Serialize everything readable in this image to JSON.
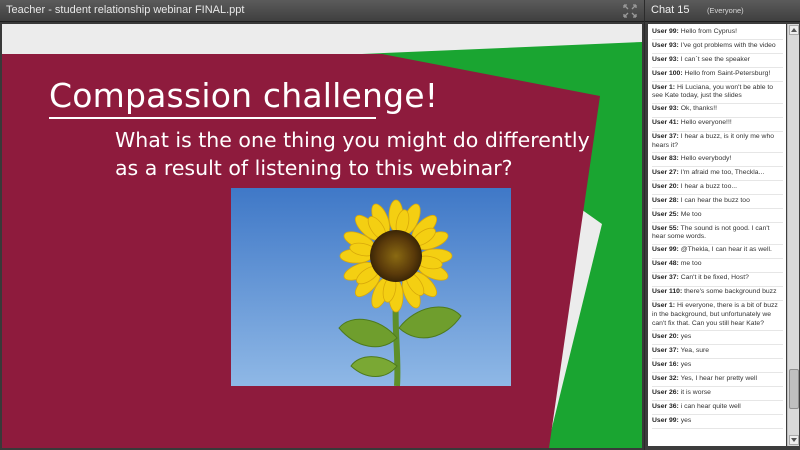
{
  "presentation": {
    "title": "Teacher - student relationship webinar FINAL.ppt",
    "slide": {
      "heading": "Compassion challenge!",
      "question": "What is the one thing you might do differently as a result of listening to this webinar?"
    }
  },
  "chat": {
    "title": "Chat 15",
    "scope": "(Everyone)",
    "messages": [
      {
        "user": "User 99:",
        "text": "Hello from Cyprus!"
      },
      {
        "user": "User 93:",
        "text": "I've got problems with the video"
      },
      {
        "user": "User 93:",
        "text": "I can`t see the speaker"
      },
      {
        "user": "User 100:",
        "text": "Hello from Saint-Petersburg!"
      },
      {
        "user": "User 1:",
        "text": "Hi Luciana, you won't be able to see Kate today, just the slides"
      },
      {
        "user": "User 93:",
        "text": "Ok, thanks!!"
      },
      {
        "user": "User 41:",
        "text": "Hello everyone!!!"
      },
      {
        "user": "User 37:",
        "text": "I hear a buzz, is it only me who hears it?"
      },
      {
        "user": "User 83:",
        "text": "Hello everybody!"
      },
      {
        "user": "User 27:",
        "text": "I'm afraid me too, Theckla..."
      },
      {
        "user": "User 20:",
        "text": "I hear a buzz too..."
      },
      {
        "user": "User 28:",
        "text": "I can hear the buzz too"
      },
      {
        "user": "User 25:",
        "text": "Me too"
      },
      {
        "user": "User 55:",
        "text": "The sound is not good. I can't hear some words."
      },
      {
        "user": "User 99:",
        "text": "@Thekla, I can hear it as well."
      },
      {
        "user": "User 48:",
        "text": "me too"
      },
      {
        "user": "User 37:",
        "text": "Can't it be fixed, Host?"
      },
      {
        "user": "User 110:",
        "text": "there's some background buzz"
      },
      {
        "user": "User 1:",
        "text": "Hi everyone, there is a bit of buzz in the background, but unfortunately we can't fix that.  Can you still hear Kate?"
      },
      {
        "user": "User 20:",
        "text": "yes"
      },
      {
        "user": "User 37:",
        "text": "Yea, sure"
      },
      {
        "user": "User 16:",
        "text": "yes"
      },
      {
        "user": "User 32:",
        "text": "Yes, I hear her pretty well"
      },
      {
        "user": "User 26:",
        "text": "it is worse"
      },
      {
        "user": "User 36:",
        "text": "i can hear quite well"
      },
      {
        "user": "User 99:",
        "text": "yes"
      }
    ]
  },
  "colors": {
    "slide_maroon": "#8e1b3d",
    "slide_green": "#1aa531",
    "sky_blue": "#5b8fcf"
  },
  "icons": {
    "expand": "expand-arrows-icon"
  }
}
